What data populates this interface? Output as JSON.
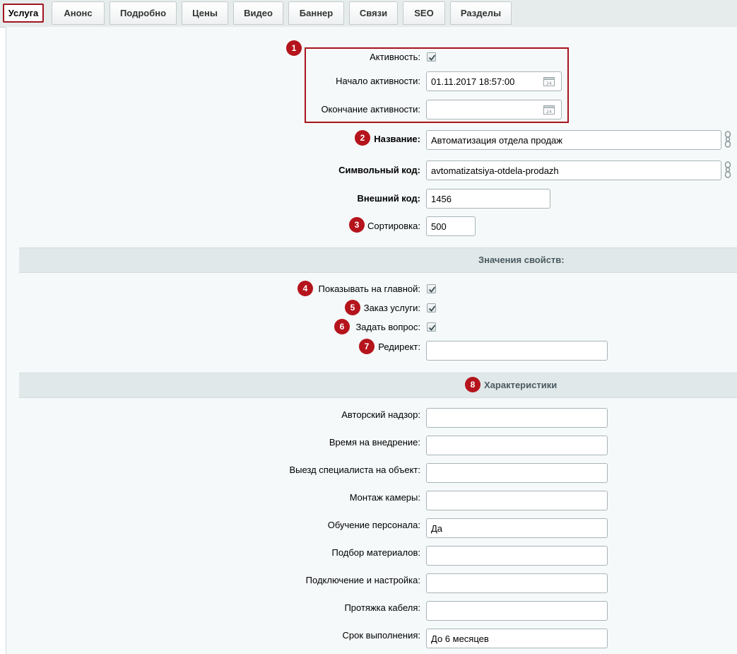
{
  "tabs": [
    "Услуга",
    "Анонс",
    "Подробно",
    "Цены",
    "Видео",
    "Баннер",
    "Связи",
    "SEO",
    "Разделы"
  ],
  "badges": [
    "1",
    "2",
    "3",
    "4",
    "5",
    "6",
    "7",
    "8"
  ],
  "activity": {
    "active_label": "Активность:",
    "active_checked": true,
    "start_label": "Начало активности:",
    "start_value": "01.11.2017 18:57:00",
    "end_label": "Окончание активности:",
    "end_value": ""
  },
  "fields": {
    "name_label": "Название:",
    "name_value": "Автоматизация отдела продаж",
    "code_label": "Символьный код:",
    "code_value": "avtomatizatsiya-otdela-prodazh",
    "xml_label": "Внешний код:",
    "xml_value": "1456",
    "sort_label": "Сортировка:",
    "sort_value": "500"
  },
  "props": {
    "section_title": "Значения свойств:",
    "show_main_label": "Показывать на главной:",
    "show_main_checked": true,
    "order_label": "Заказ услуги:",
    "order_checked": true,
    "ask_label": "Задать вопрос:",
    "ask_checked": true,
    "redirect_label": "Редирект:",
    "redirect_value": ""
  },
  "characteristics": {
    "section_title": "Характеристики",
    "items": [
      {
        "label": "Авторский надзор:",
        "value": ""
      },
      {
        "label": "Время на внедрение:",
        "value": ""
      },
      {
        "label": "Выезд специалиста на объект:",
        "value": ""
      },
      {
        "label": "Монтаж камеры:",
        "value": ""
      },
      {
        "label": "Обучение персонала:",
        "value": "Да"
      },
      {
        "label": "Подбор материалов:",
        "value": ""
      },
      {
        "label": "Подключение и настройка:",
        "value": ""
      },
      {
        "label": "Протяжка кабеля:",
        "value": ""
      },
      {
        "label": "Срок выполнения:",
        "value": "До 6 месяцев"
      }
    ]
  },
  "icons": {
    "calendar": "calendar-icon",
    "link": "chain-link-icon",
    "check": "checkmark-icon"
  },
  "colors": {
    "accent_red": "#a7141c",
    "section_bg": "#e0e8e9",
    "frame_bg": "#f5f9f9"
  }
}
